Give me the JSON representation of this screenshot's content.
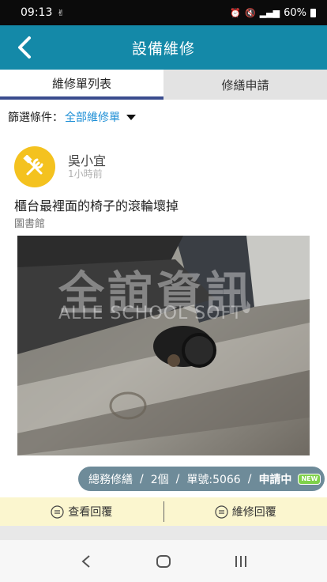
{
  "status_bar": {
    "time": "09:13",
    "battery": "60%"
  },
  "header": {
    "title": "設備維修"
  },
  "tabs": [
    {
      "label": "維修單列表"
    },
    {
      "label": "修繕申請"
    }
  ],
  "filter": {
    "label": "篩選條件：",
    "value": "全部維修單"
  },
  "post": {
    "author": "吳小宜",
    "time": "1小時前",
    "title": "櫃台最裡面的椅子的滾輪壞掉",
    "location": "圖書館",
    "watermark_cn": "全誼資訊",
    "watermark_en": "ALLE SCHOOL SOFT"
  },
  "status": {
    "department": "總務修繕",
    "count": "2個",
    "order_no": "單號:5066",
    "state": "申請中",
    "badge": "NEW"
  },
  "actions": [
    {
      "label": "查看回覆"
    },
    {
      "label": "維修回覆"
    }
  ],
  "colors": {
    "header": "#1489a8",
    "avatar": "#f4c21f",
    "link": "#1e8fd6",
    "pill": "#6e8b99",
    "action_bar": "#fbf6cf"
  }
}
